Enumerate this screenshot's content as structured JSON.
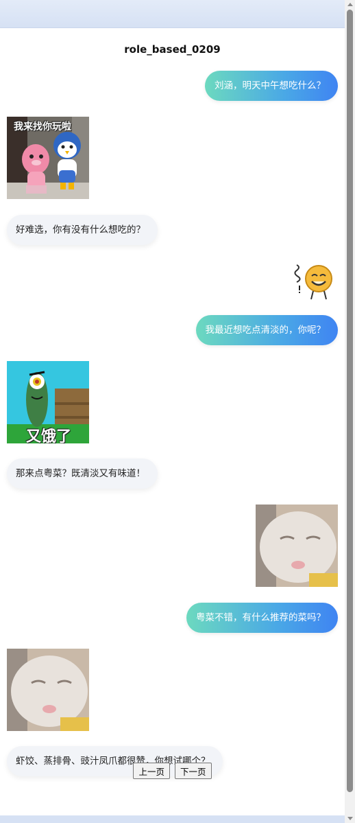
{
  "page": {
    "title": "role_based_0209"
  },
  "messages": [
    {
      "role": "user",
      "type": "text",
      "text": "刘涵，明天中午想吃什么？"
    },
    {
      "role": "assistant",
      "type": "sticker",
      "sticker": "penguin-beaver-sticker",
      "caption": "我来找你玩啦"
    },
    {
      "role": "assistant",
      "type": "text",
      "text": "好难选，你有没有什么想吃的？"
    },
    {
      "role": "user",
      "type": "sticker",
      "sticker": "smiley-face-sticker"
    },
    {
      "role": "user",
      "type": "text",
      "text": "我最近想吃点清淡的，你呢？"
    },
    {
      "role": "assistant",
      "type": "sticker",
      "sticker": "plankton-sticker",
      "caption": "又饿了"
    },
    {
      "role": "assistant",
      "type": "text",
      "text": "那来点粤菜？既清淡又有味道！"
    },
    {
      "role": "user",
      "type": "sticker",
      "sticker": "white-cat-sticker"
    },
    {
      "role": "user",
      "type": "text",
      "text": "粤菜不错，有什么推荐的菜吗？"
    },
    {
      "role": "assistant",
      "type": "sticker",
      "sticker": "white-cat-sticker"
    },
    {
      "role": "assistant",
      "type": "text",
      "text": "虾饺、蒸排骨、豉汁凤爪都很赞，你想试哪个？"
    }
  ],
  "pager": {
    "prev_label": "上一页",
    "next_label": "下一页"
  },
  "colors": {
    "user_bubble_start": "#6cd9bf",
    "user_bubble_end": "#3f84f2",
    "bot_bubble": "#f2f4f8",
    "background_band": "#dbe5f5"
  }
}
